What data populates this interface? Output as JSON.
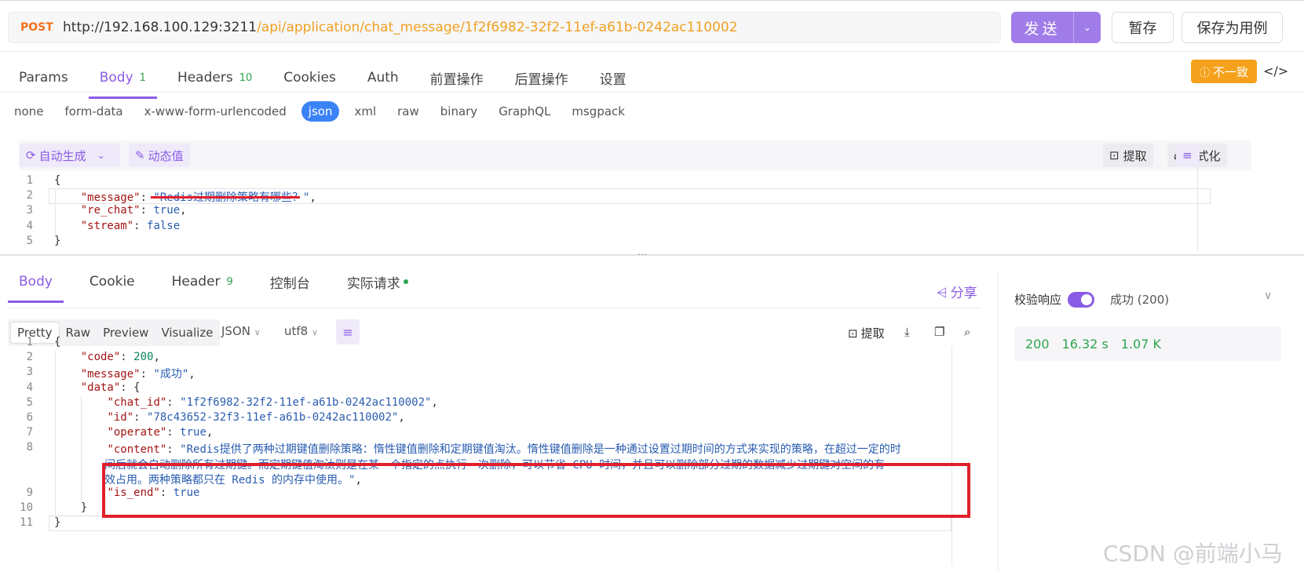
{
  "request": {
    "method": "POST",
    "url_base": "http://192.168.100.129:3211",
    "url_path": "/api/application/chat_message/1f2f6982-32f2-11ef-a61b-0242ac110002",
    "send_label": "发送",
    "save_label": "暂存",
    "save_case_label": "保存为用例"
  },
  "req_tabs": [
    {
      "label": "Params",
      "count": ""
    },
    {
      "label": "Body",
      "count": "1"
    },
    {
      "label": "Headers",
      "count": "10"
    },
    {
      "label": "Cookies",
      "count": ""
    },
    {
      "label": "Auth",
      "count": ""
    },
    {
      "label": "前置操作",
      "count": ""
    },
    {
      "label": "后置操作",
      "count": ""
    },
    {
      "label": "设置",
      "count": ""
    }
  ],
  "mismatch_label": "不一致",
  "body_types": [
    "none",
    "form-data",
    "x-www-form-urlencoded",
    "json",
    "xml",
    "raw",
    "binary",
    "GraphQL",
    "msgpack"
  ],
  "editor_tools": {
    "auto_generate": "自动生成",
    "dynamic_value": "动态值",
    "extract": "提取",
    "format": "格式化"
  },
  "request_body_lines": [
    "{",
    "    \"message\": \"Redis过期删除策略有哪些？\",",
    "    \"re_chat\": true,",
    "    \"stream\": false",
    "}"
  ],
  "resp_tabs": [
    {
      "label": "Body",
      "count": ""
    },
    {
      "label": "Cookie",
      "count": ""
    },
    {
      "label": "Header",
      "count": "9"
    },
    {
      "label": "控制台",
      "count": ""
    },
    {
      "label": "实际请求",
      "count": ""
    }
  ],
  "share_label": "分享",
  "view_modes": [
    "Pretty",
    "Raw",
    "Preview",
    "Visualize"
  ],
  "format_select": "JSON",
  "encoding_select": "utf8",
  "resp_tools": {
    "extract": "提取"
  },
  "verify_label": "校验响应",
  "verify_status": "成功 (200)",
  "status": {
    "code": "200",
    "time": "16.32 s",
    "size": "1.07 K"
  },
  "response_lines": [
    "{",
    "    \"code\": 200,",
    "    \"message\": \"成功\",",
    "    \"data\": {",
    "        \"chat_id\": \"1f2f6982-32f2-11ef-a61b-0242ac110002\",",
    "        \"id\": \"78c43652-32f3-11ef-a61b-0242ac110002\",",
    "        \"operate\": true,",
    "        \"content\": \"Redis提供了两种过期键值删除策略：惰性键值删除和定期键值淘汰。惰性键值删除是一种通过设置过期时间的方式来实现的策略，在超过一定的时",
    "间后就会自动删除所有过期键。而定期键值淘汰则是在某一个指定的点执行一次删除，可以节省 CPU 时间，并且可以删除部分过期的数据减少过期键对空间的有",
    "效占用。两种策略都只在 Redis 的内存中使用。\",",
    "        \"is_end\": true",
    "    }",
    "}"
  ],
  "response_line_numbers": [
    "1",
    "2",
    "3",
    "4",
    "5",
    "6",
    "7",
    "8",
    "",
    "",
    "9",
    "10",
    "11"
  ],
  "watermark": "CSDN @前端小马",
  "colors": {
    "accent": "#8a5ce6",
    "warning": "#f5a11b",
    "success": "#2ea44f",
    "annotation": "#e0202c"
  }
}
